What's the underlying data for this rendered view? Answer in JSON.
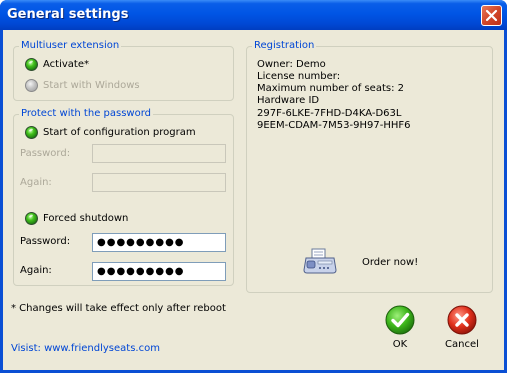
{
  "window": {
    "title": "General settings"
  },
  "multiuser": {
    "group_title": "Multiuser extension",
    "activate_label": "Activate*",
    "start_label": "Start with Windows"
  },
  "password": {
    "group_title": "Protect with the password",
    "start_config_label": "Start of configuration program",
    "password_label_1": "Password:",
    "again_label_1": "Again:",
    "password_value_1": "",
    "again_value_1": "",
    "forced_label": "Forced shutdown",
    "password_label_2": "Password:",
    "again_label_2": "Again:",
    "password_value_2": "●●●●●●●●●",
    "again_value_2": "●●●●●●●●●"
  },
  "registration": {
    "group_title": "Registration",
    "owner": "Owner: Demo",
    "license": "License number:",
    "max_seats": "Maximum number of seats: 2",
    "hardware_label": "Hardware ID",
    "hardware_id_1": "297F-6LKE-7FHD-D4KA-D63L",
    "hardware_id_2": "9EEM-CDAM-7M53-9H97-HHF6",
    "order_label": "Order now!"
  },
  "footer": {
    "note": "* Changes will take effect only after reboot",
    "link": "Visist: www.friendlyseats.com",
    "ok_label": "OK",
    "cancel_label": "Cancel"
  },
  "colors": {
    "titlebar": "#0055e5",
    "group_title": "#0046d5",
    "dialog_bg": "#ece9d8",
    "active_led": "#43c21c"
  },
  "icons": {
    "close": "close-icon",
    "fax": "fax-icon",
    "ok": "checkmark-icon",
    "cancel": "x-circle-icon"
  }
}
